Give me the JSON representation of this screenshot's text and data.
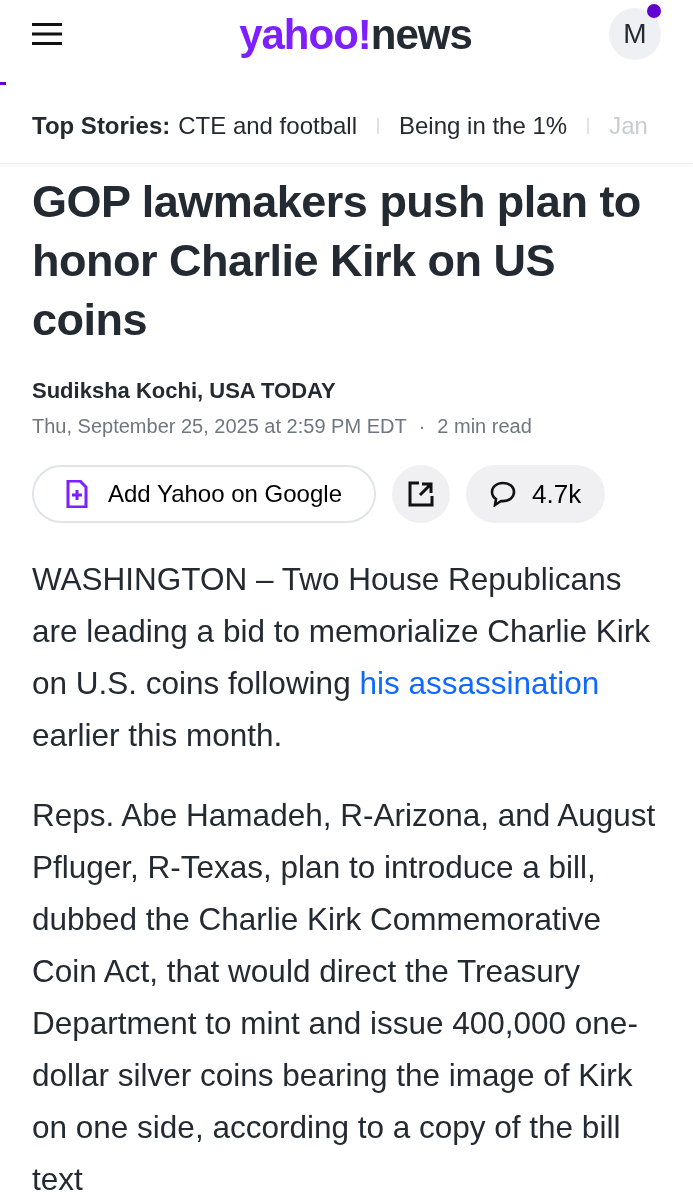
{
  "header": {
    "logo_brand": "yahoo!",
    "logo_section": "news",
    "avatar_initial": "M",
    "notification_dot": true
  },
  "top_stories": {
    "label": "Top Stories:",
    "items": [
      {
        "text": "CTE and football",
        "faded": false
      },
      {
        "text": "Being in the 1%",
        "faded": false
      },
      {
        "text": "Jan",
        "faded": true
      }
    ]
  },
  "article": {
    "headline": "GOP lawmakers push plan to honor Charlie Kirk on US coins",
    "byline": "Sudiksha Kochi, USA TODAY",
    "date": "Thu, September 25, 2025 at 2:59 PM EDT",
    "meta_separator": "·",
    "read_time": "2 min read",
    "actions": {
      "add_button": "Add Yahoo on Google",
      "comments": "4.7k"
    },
    "paragraphs": [
      {
        "before": "WASHINGTON – Two House Republicans are leading a bid to memorialize Charlie Kirk on U.S. coins following ",
        "link": "his assassination",
        "after": " earlier this month."
      },
      {
        "before": "Reps. Abe Hamadeh, R-Arizona, and August Pfluger, R-Texas, plan to introduce a bill, dubbed the Charlie Kirk Commemorative Coin Act, that would direct the Treasury Department to mint and issue 400,000 one-dollar silver coins bearing the image of Kirk on one side, according to a copy of the bill text"
      }
    ]
  }
}
